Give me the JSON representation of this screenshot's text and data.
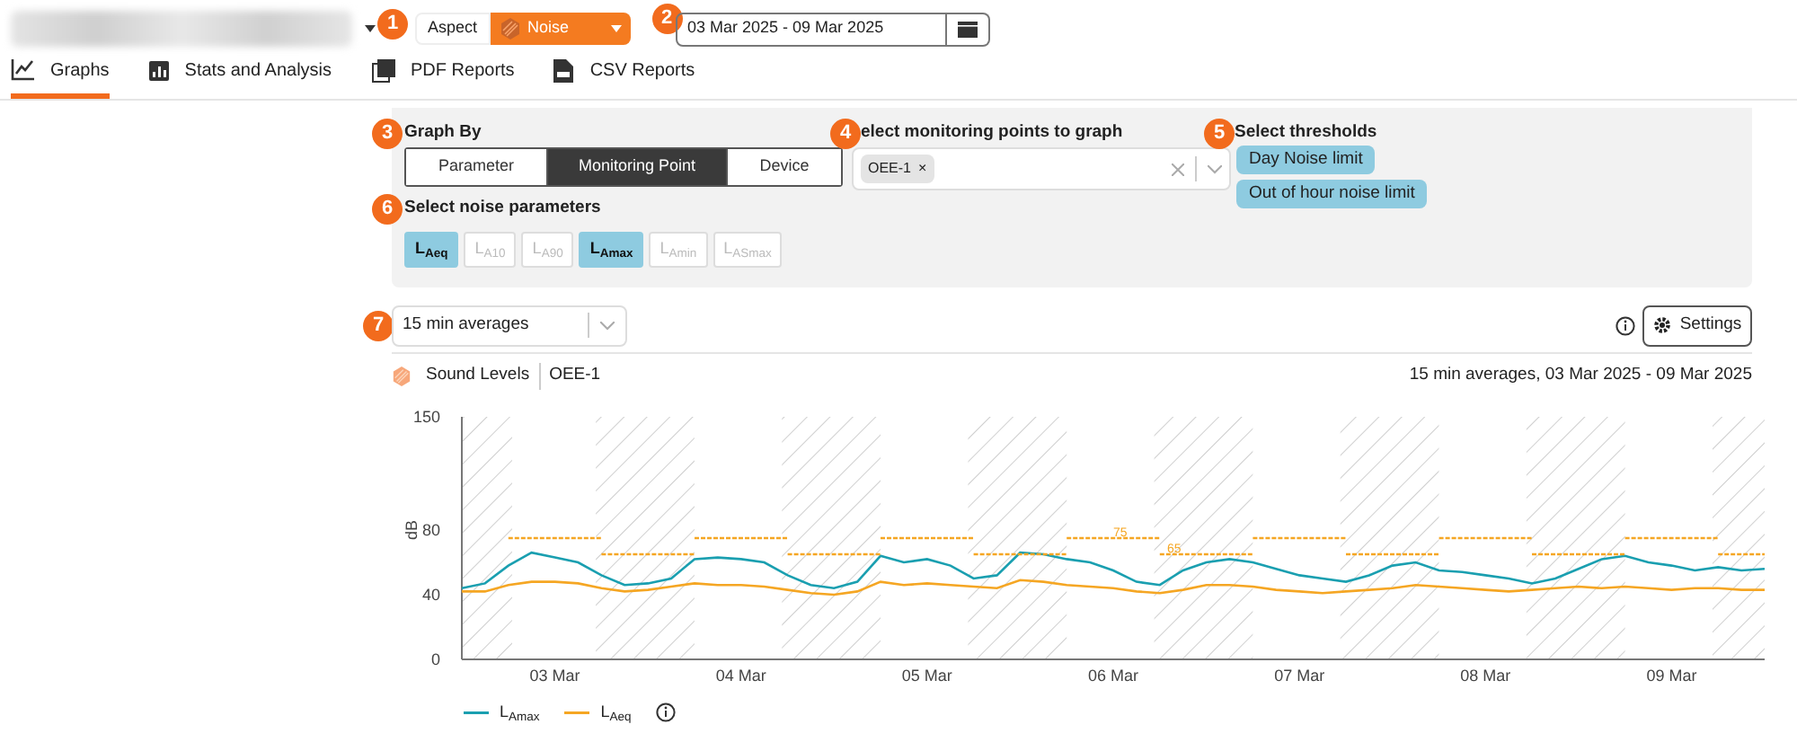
{
  "top_bar": {
    "callout": "1",
    "aspect_label": "Aspect",
    "aspect_value": "Noise",
    "date_callout": "2",
    "date_range": "03 Mar 2025 - 09 Mar 2025"
  },
  "tabs": [
    {
      "label": "Graphs",
      "kind": "graph",
      "selected": true
    },
    {
      "label": "Stats and Analysis",
      "kind": "stats",
      "selected": false
    },
    {
      "label": "PDF Reports",
      "kind": "pdf",
      "selected": false
    },
    {
      "label": "CSV Reports",
      "kind": "csv",
      "selected": false
    }
  ],
  "graph_by": {
    "callout": "3",
    "title": "Graph By",
    "options": [
      {
        "label": "Parameter",
        "selected": false
      },
      {
        "label": "Monitoring Point",
        "selected": true
      },
      {
        "label": "Device",
        "selected": false
      }
    ]
  },
  "monitoring_points": {
    "callout": "4",
    "title": "elect monitoring points to graph",
    "chips": [
      "OEE-1"
    ],
    "remove_symbol": "×"
  },
  "thresholds": {
    "callout": "5",
    "title": "Select thresholds",
    "chips": [
      "Day Noise limit",
      "Out of hour noise limit"
    ]
  },
  "noise_parameters": {
    "callout": "6",
    "title": "Select noise parameters",
    "options": [
      {
        "label": "L$_{Aeq}$",
        "selected": true
      },
      {
        "label": "L$_{A10}$",
        "selected": false
      },
      {
        "label": "L$_{A90}$",
        "selected": false
      },
      {
        "label": "L$_{Amax}$",
        "selected": true
      },
      {
        "label": "L$_{Amin}$",
        "selected": false
      },
      {
        "label": "L$_{ASmax}$",
        "selected": false
      }
    ]
  },
  "averaging": {
    "callout": "7",
    "value": "15 min averages"
  },
  "settings_button": "Settings",
  "chart_header": {
    "title": "Sound Levels",
    "point": "OEE-1",
    "summary": "15 min averages, 03 Mar 2025 - 09 Mar 2025"
  },
  "chart_data": {
    "type": "line",
    "ylabel": "dB",
    "ylim": [
      0,
      150
    ],
    "yticks": [
      0,
      40,
      80,
      150
    ],
    "categories": [
      null,
      null,
      null,
      null,
      "03 Mar",
      null,
      null,
      null,
      null,
      null,
      null,
      null,
      "04 Mar",
      null,
      null,
      null,
      null,
      null,
      null,
      null,
      "05 Mar",
      null,
      null,
      null,
      null,
      null,
      null,
      null,
      "06 Mar",
      null,
      null,
      null,
      null,
      null,
      null,
      null,
      "07 Mar",
      null,
      null,
      null,
      null,
      null,
      null,
      null,
      "08 Mar",
      null,
      null,
      null,
      null,
      null,
      null,
      null,
      "09 Mar",
      null,
      null,
      null,
      null
    ],
    "series": [
      {
        "name": "L$_{Amax}$",
        "color": "#1a9fb0",
        "values": [
          44,
          47,
          58,
          66,
          63,
          60,
          52,
          46,
          47,
          50,
          62,
          63,
          62,
          60,
          52,
          46,
          44,
          48,
          64,
          60,
          62,
          58,
          50,
          52,
          66,
          65,
          62,
          60,
          55,
          48,
          46,
          55,
          60,
          62,
          60,
          56,
          52,
          50,
          48,
          52,
          58,
          60,
          55,
          54,
          52,
          50,
          47,
          50,
          56,
          62,
          64,
          60,
          58,
          55,
          57,
          55,
          56
        ]
      },
      {
        "name": "L$_{Aeq}$",
        "color": "#f5a623",
        "values": [
          42,
          42,
          46,
          48,
          48,
          47,
          44,
          42,
          43,
          45,
          47,
          46,
          46,
          45,
          43,
          41,
          40,
          42,
          48,
          46,
          47,
          46,
          45,
          44,
          49,
          48,
          46,
          45,
          44,
          42,
          41,
          43,
          46,
          46,
          45,
          43,
          42,
          41,
          42,
          43,
          44,
          46,
          45,
          44,
          43,
          42,
          43,
          44,
          45,
          44,
          45,
          44,
          43,
          44,
          44,
          43,
          43
        ]
      },
      {
        "color": "#f5a623",
        "line_style": "dotted",
        "values": [
          null,
          null,
          75,
          75,
          75,
          75,
          75,
          null,
          null,
          null,
          75,
          75,
          75,
          75,
          75,
          null,
          null,
          null,
          75,
          75,
          75,
          75,
          75,
          null,
          null,
          null,
          75,
          75,
          75,
          75,
          75,
          null,
          null,
          null,
          75,
          75,
          75,
          75,
          75,
          null,
          null,
          null,
          75,
          75,
          75,
          75,
          75,
          null,
          null,
          null,
          75,
          75,
          75,
          75,
          75,
          null,
          null
        ]
      },
      {
        "color": "#f5a623",
        "line_style": "dotted",
        "values": [
          null,
          null,
          null,
          null,
          null,
          null,
          65,
          65,
          65,
          65,
          65,
          null,
          null,
          null,
          65,
          65,
          65,
          65,
          65,
          null,
          null,
          null,
          65,
          65,
          65,
          65,
          65,
          null,
          null,
          null,
          65,
          65,
          65,
          65,
          65,
          null,
          null,
          null,
          65,
          65,
          65,
          65,
          65,
          null,
          null,
          null,
          65,
          65,
          65,
          65,
          65,
          null,
          null,
          null,
          65,
          65,
          65
        ]
      }
    ],
    "annotations": [
      {
        "text": "75",
        "x": "06 Mar",
        "y": 75
      },
      "65"
    ]
  }
}
